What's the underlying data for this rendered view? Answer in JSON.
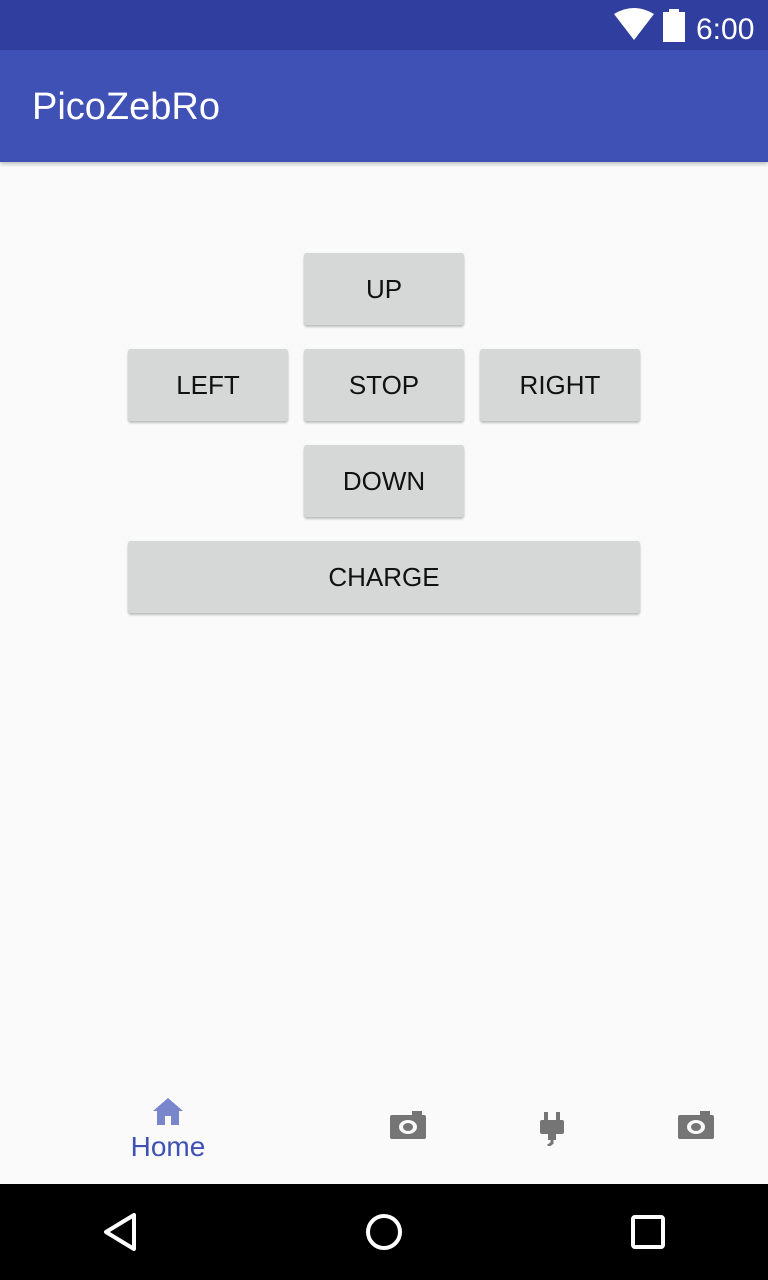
{
  "status_bar": {
    "time": "6:00",
    "icons": [
      "wifi-icon",
      "battery-icon"
    ]
  },
  "app_bar": {
    "title": "PicoZebRo"
  },
  "controls": {
    "up": "UP",
    "left": "LEFT",
    "stop": "STOP",
    "right": "RIGHT",
    "down": "DOWN",
    "charge": "CHARGE"
  },
  "bottom_nav": {
    "items": [
      {
        "label": "Home",
        "icon": "home-icon",
        "selected": true
      },
      {
        "label": "",
        "icon": "camera-icon",
        "selected": false
      },
      {
        "label": "",
        "icon": "plug-icon",
        "selected": false
      },
      {
        "label": "",
        "icon": "camera-icon",
        "selected": false
      }
    ]
  },
  "system_nav": {
    "icons": [
      "back-icon",
      "home-circle-icon",
      "recents-icon"
    ]
  },
  "colors": {
    "primary": "#3f51b5",
    "primary_dark": "#303f9f",
    "button": "#d6d7d7",
    "nav_inactive": "#757575"
  }
}
